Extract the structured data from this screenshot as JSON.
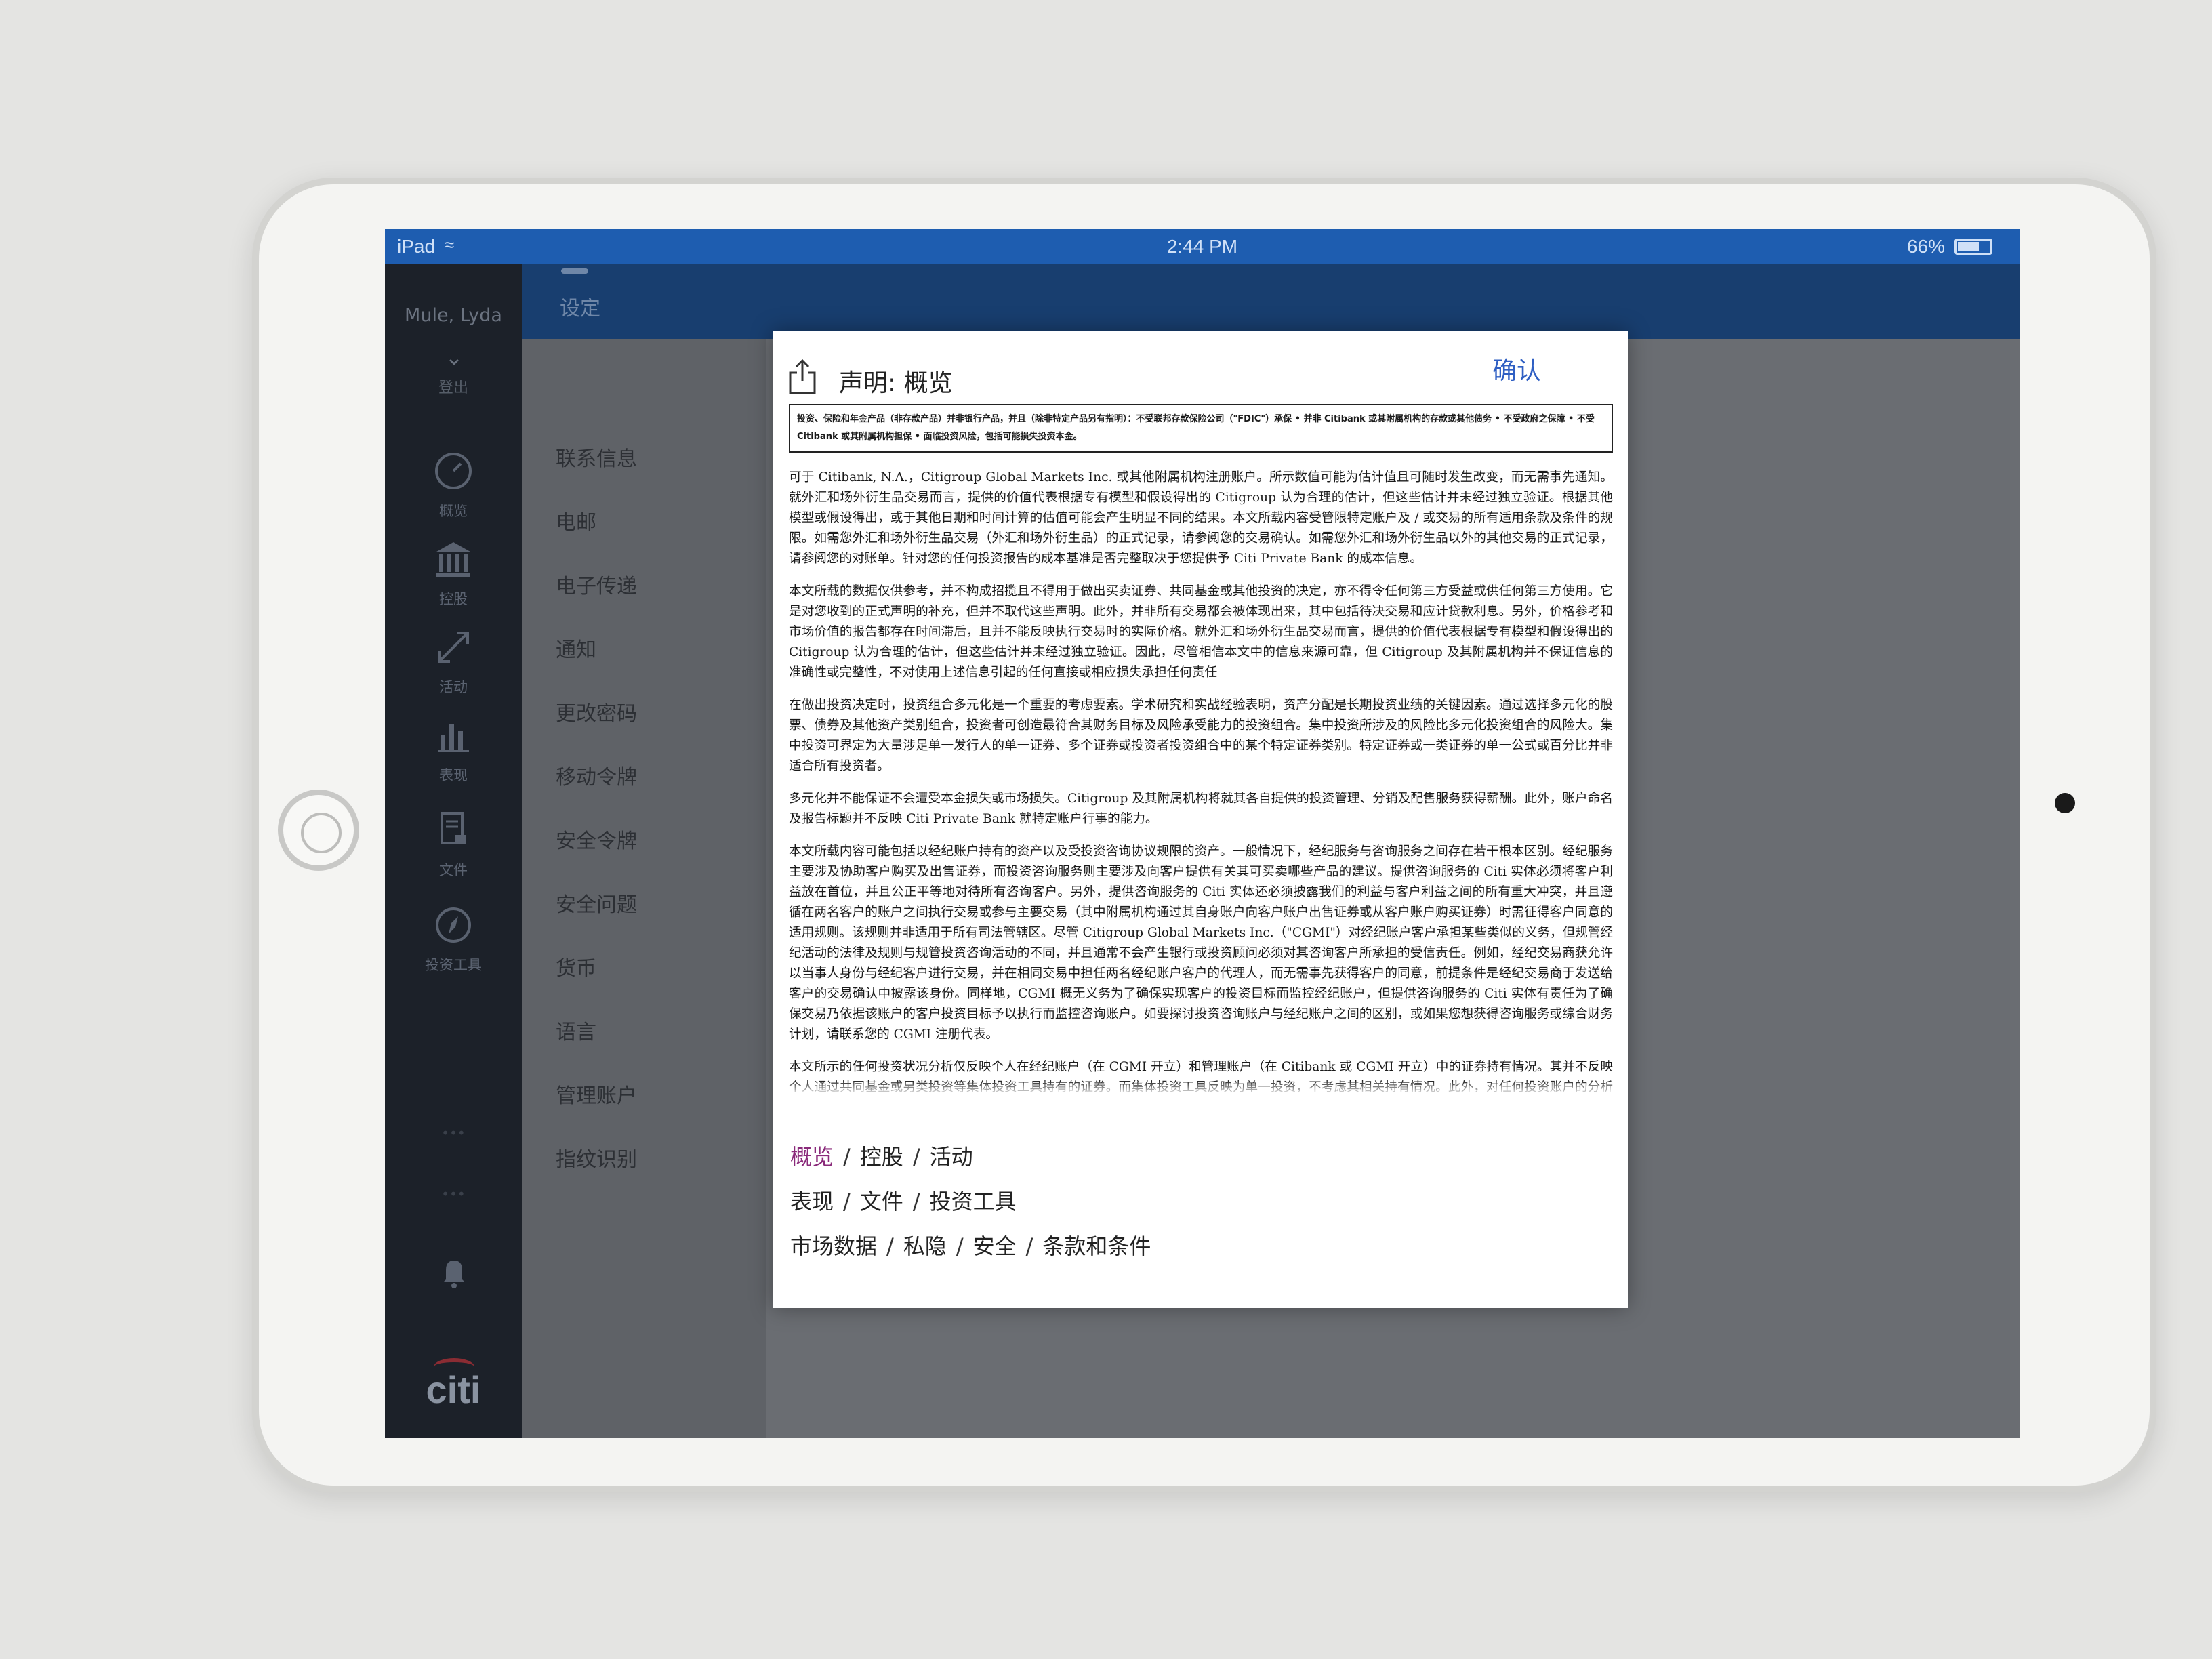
{
  "status_bar": {
    "device": "iPad",
    "time": "2:44 PM",
    "battery": "66%"
  },
  "header": {
    "title": "设定"
  },
  "sidebar": {
    "user": "Mule, Lyda",
    "logout": "登出",
    "items": [
      {
        "label": "概览",
        "icon": "gauge-icon"
      },
      {
        "label": "控股",
        "icon": "bank-icon"
      },
      {
        "label": "活动",
        "icon": "arrows-icon"
      },
      {
        "label": "表现",
        "icon": "bar-chart-icon"
      },
      {
        "label": "文件",
        "icon": "document-lock-icon"
      },
      {
        "label": "投资工具",
        "icon": "compass-icon"
      }
    ],
    "brand": "citi"
  },
  "settings": {
    "items": [
      "联系信息",
      "电邮",
      "电子传递",
      "通知",
      "更改密码",
      "移动令牌",
      "安全令牌",
      "安全问题",
      "货币",
      "语言",
      "管理账户",
      "指纹识别"
    ]
  },
  "modal": {
    "title": "声明: 概览",
    "confirm": "确认",
    "disclaimer": "投资、保险和年金产品（非存款产品）并非银行产品，并且（除非特定产品另有指明）：不受联邦存款保险公司（\"FDIC\"）承保 • 并非 Citibank 或其附属机构的存款或其他债务 • 不受政府之保障 • 不受 Citibank 或其附属机构担保 • 面临投资风险，包括可能损失投资本金。",
    "paragraphs": [
      "可于 Citibank, N.A.，Citigroup Global Markets Inc. 或其他附属机构注册账户。所示数值可能为估计值且可随时发生改变，而无需事先通知。就外汇和场外衍生品交易而言，提供的价值代表根据专有模型和假设得出的 Citigroup 认为合理的估计，但这些估计并未经过独立验证。根据其他模型或假设得出，或于其他日期和时间计算的估值可能会产生明显不同的结果。本文所载内容受管限特定账户及 / 或交易的所有适用条款及条件的规限。如需您外汇和场外衍生品交易（外汇和场外衍生品）的正式记录，请参阅您的交易确认。如需您外汇和场外衍生品以外的其他交易的正式记录，请参阅您的对账单。针对您的任何投资报告的成本基准是否完整取决于您提供予 Citi Private Bank 的成本信息。",
      "本文所载的数据仅供参考，并不构成招揽且不得用于做出买卖证券、共同基金或其他投资的决定，亦不得令任何第三方受益或供任何第三方使用。它是对您收到的正式声明的补充，但并不取代这些声明。此外，并非所有交易都会被体现出来，其中包括待决交易和应计贷款利息。另外，价格参考和市场价值的报告都存在时间滞后，且并不能反映执行交易时的实际价格。就外汇和场外衍生品交易而言，提供的价值代表根据专有模型和假设得出的 Citigroup 认为合理的估计，但这些估计并未经过独立验证。因此，尽管相信本文中的信息来源可靠，但 Citigroup 及其附属机构并不保证信息的准确性或完整性，不对使用上述信息引起的任何直接或相应损失承担任何责任",
      "在做出投资决定时，投资组合多元化是一个重要的考虑要素。学术研究和实战经验表明，资产分配是长期投资业绩的关键因素。通过选择多元化的股票、债券及其他资产类别组合，投资者可创造最符合其财务目标及风险承受能力的投资组合。集中投资所涉及的风险比多元化投资组合的风险大。集中投资可界定为大量涉足单一发行人的单一证券、多个证券或投资者投资组合中的某个特定证券类别。特定证券或一类证券的单一公式或百分比并非适合所有投资者。",
      "多元化并不能保证不会遭受本金损失或市场损失。Citigroup 及其附属机构将就其各自提供的投资管理、分销及配售服务获得薪酬。此外，账户命名及报告标题并不反映 Citi Private Bank 就特定账户行事的能力。",
      "本文所载内容可能包括以经纪账户持有的资产以及受投资咨询协议规限的资产。一般情况下，经纪服务与咨询服务之间存在若干根本区别。经纪服务主要涉及协助客户购买及出售证券，而投资咨询服务则主要涉及向客户提供有关其可买卖哪些产品的建议。提供咨询服务的 Citi 实体必须将客户利益放在首位，并且公正平等地对待所有咨询客户。另外，提供咨询服务的 Citi 实体还必须披露我们的利益与客户利益之间的所有重大冲突，并且遵循在两名客户的账户之间执行交易或参与主要交易（其中附属机构通过其自身账户向客户账户出售证券或从客户账户购买证券）时需征得客户同意的适用规则。该规则并非适用于所有司法管辖区。尽管 Citigroup Global Markets Inc.（\"CGMI\"）对经纪账户客户承担某些类似的义务，但规管经纪活动的法律及规则与规管投资咨询活动的不同，并且通常不会产生银行或投资顾问必须对其咨询客户所承担的受信责任。例如，经纪交易商获允许以当事人身份与经纪客户进行交易，并在相同交易中担任两名经纪账户客户的代理人，而无需事先获得客户的同意，前提条件是经纪交易商于发送给客户的交易确认中披露该身份。同样地，CGMI 概无义务为了确保实现客户的投资目标而监控经纪账户，但提供咨询服务的 Citi 实体有责任为了确保交易乃依据该账户的客户投资目标予以执行而监控咨询账户。如要探讨投资咨询账户与经纪账户之间的区别，或如果您想获得咨询服务或综合财务计划，请联系您的 CGMI 注册代表。",
      "本文所示的任何投资状况分析仅反映个人在经纪账户（在 CGMI 开立）和管理账户（在 Citibank 或 CGMI 开立）中的证券持有情况。其并不反映个人通过共同基金或另类投资等集体投资工具持有的证券。而集体投资工具反映为单一投资，不考虑其相关持有情况。此外，对任何投资账户的分析均以就该单个账户建立的参数为基础，并受您对该账户做出的指示和投资组合限制的规限。分析不会跨账户进行。管理投资账户中的资产根据该账户的参数进行分配，不会跨账户，且受账户持有人（或其他获授权人士）的指示和投资组合限制（如有）规限。此外，请注意，没有账户持有人（或其他获授权人士）的明确指示，各管理投资账户中的资产分配不是初始资产之后均未经过调整或"
    ],
    "links": [
      [
        "概览",
        "控股",
        "活动"
      ],
      [
        "表现",
        "文件",
        "投资工具"
      ],
      [
        "市场数据",
        "私隐",
        "安全",
        "条款和条件"
      ]
    ],
    "active_link": "概览"
  }
}
